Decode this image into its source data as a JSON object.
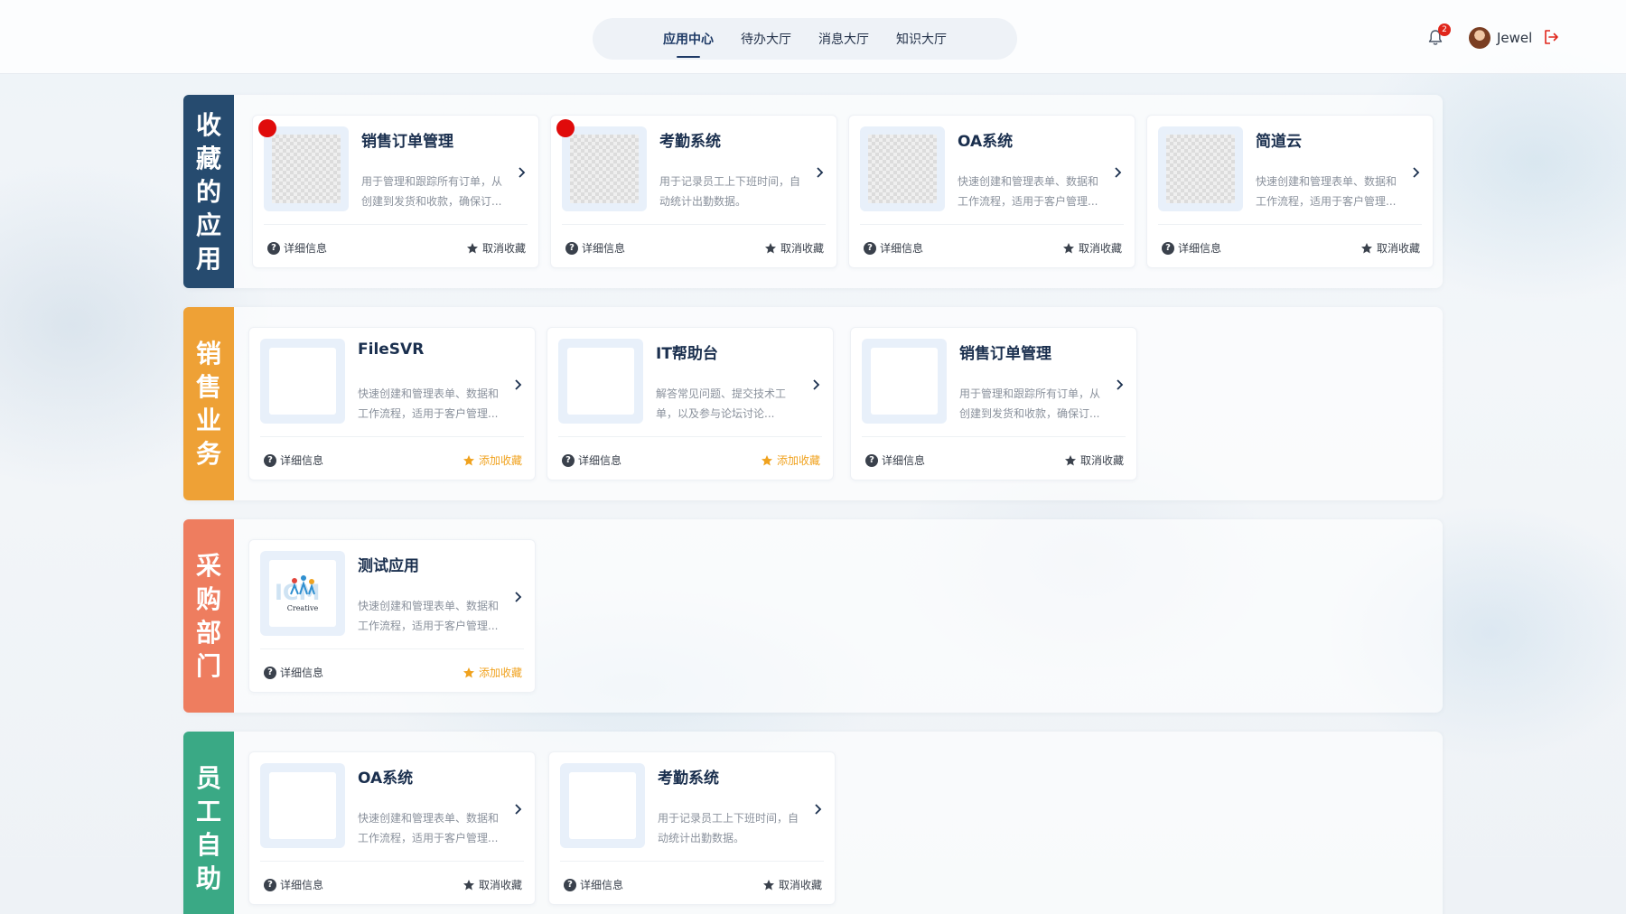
{
  "nav": {
    "tabs": [
      {
        "label": "应用中心",
        "active": true
      },
      {
        "label": "待办大厅",
        "active": false
      },
      {
        "label": "消息大厅",
        "active": false
      },
      {
        "label": "知识大厅",
        "active": false
      }
    ]
  },
  "header": {
    "notification_count": "2",
    "username": "Jewel"
  },
  "common": {
    "detail_label": "详细信息",
    "remove_fav_label": "取消收藏",
    "add_fav_label": "添加收藏"
  },
  "colors": {
    "favorites": "#264b6f",
    "sales": "#eea136",
    "purchasing": "#ee7d5f",
    "employee": "#3aa985",
    "add_fav": "#f0a21e",
    "badge": "#e0261b"
  },
  "sections": [
    {
      "label_chars": [
        "收",
        "藏",
        "的",
        "应",
        "用"
      ],
      "cards": [
        {
          "title": "销售订单管理",
          "desc": "用于管理和跟踪所有订单，从\n创建到发货和收款，确保订...",
          "fav": "取消收藏",
          "dot": true,
          "thumb": "checker"
        },
        {
          "title": "考勤系统",
          "desc": "用于记录员工上下班时间，自\n动统计出勤数据。",
          "fav": "取消收藏",
          "dot": true,
          "thumb": "checker"
        },
        {
          "title": "OA系统",
          "desc": "快速创建和管理表单、数据和\n工作流程，适用于客户管理...",
          "fav": "取消收藏",
          "dot": false,
          "thumb": "checker"
        },
        {
          "title": "简道云",
          "desc": "快速创建和管理表单、数据和\n工作流程，适用于客户管理...",
          "fav": "取消收藏",
          "dot": false,
          "thumb": "checker"
        }
      ]
    },
    {
      "label_chars": [
        "销",
        "售",
        "业",
        "务"
      ],
      "cards": [
        {
          "title": "FileSVR",
          "desc": "快速创建和管理表单、数据和\n工作流程，适用于客户管理...",
          "fav": "添加收藏",
          "thumb": "blank"
        },
        {
          "title": "IT帮助台",
          "desc": "解答常见问题、提交技术工\n单，以及参与论坛讨论...",
          "fav": "添加收藏",
          "thumb": "blank"
        },
        {
          "title": "销售订单管理",
          "desc": "用于管理和跟踪所有订单，从\n创建到发货和收款，确保订...",
          "fav": "取消收藏",
          "thumb": "blank"
        }
      ]
    },
    {
      "label_chars": [
        "采",
        "购",
        "部",
        "门"
      ],
      "cards": [
        {
          "title": "测试应用",
          "desc": "快速创建和管理表单、数据和\n工作流程，适用于客户管理...",
          "fav": "添加收藏",
          "thumb": "logo",
          "logo_text": "Creative"
        }
      ]
    },
    {
      "label_chars": [
        "员",
        "工",
        "自",
        "助"
      ],
      "cards": [
        {
          "title": "OA系统",
          "desc": "快速创建和管理表单、数据和\n工作流程，适用于客户管理...",
          "fav": "取消收藏",
          "thumb": "blank"
        },
        {
          "title": "考勤系统",
          "desc": "用于记录员工上下班时间，自\n动统计出勤数据。",
          "fav": "取消收藏",
          "thumb": "blank"
        }
      ]
    }
  ]
}
